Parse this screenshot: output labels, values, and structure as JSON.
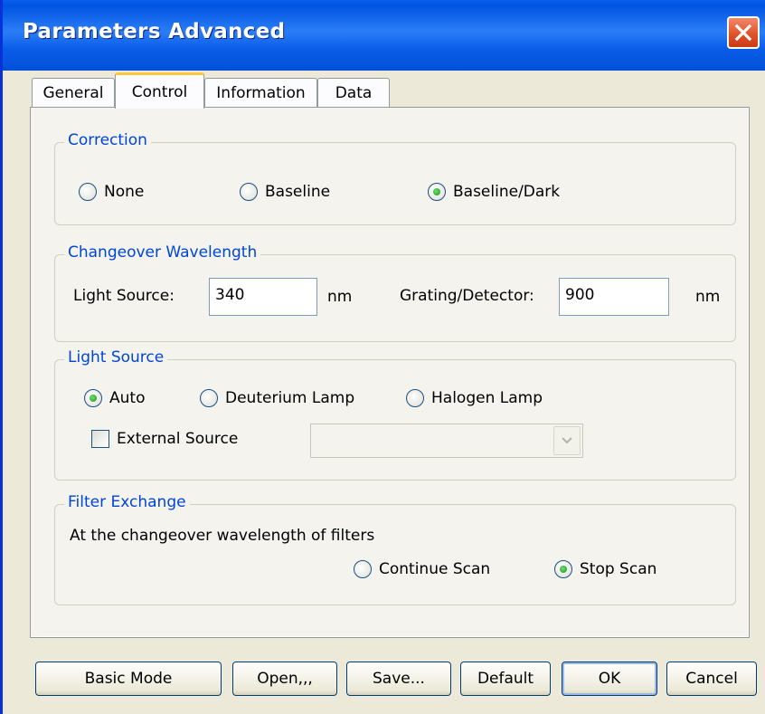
{
  "window": {
    "title": "Parameters  Advanced"
  },
  "tabs": [
    {
      "label": "General"
    },
    {
      "label": "Control"
    },
    {
      "label": "Information"
    },
    {
      "label": "Data"
    }
  ],
  "correction": {
    "label": "Correction",
    "options": [
      {
        "label": "None",
        "selected": false
      },
      {
        "label": "Baseline",
        "selected": false
      },
      {
        "label": "Baseline/Dark",
        "selected": true
      }
    ]
  },
  "changeover": {
    "label": "Changeover Wavelength",
    "light_source_label": "Light Source:",
    "light_source_value": "340",
    "light_source_unit": "nm",
    "grating_label": "Grating/Detector:",
    "grating_value": "900",
    "grating_unit": "nm"
  },
  "light_source": {
    "label": "Light Source",
    "options": [
      {
        "label": "Auto",
        "selected": true
      },
      {
        "label": "Deuterium Lamp",
        "selected": false
      },
      {
        "label": "Halogen Lamp",
        "selected": false
      }
    ],
    "external_label": "External Source",
    "external_checked": false,
    "external_combo_value": ""
  },
  "filter_exchange": {
    "label": "Filter Exchange",
    "description": "At the changeover wavelength of filters",
    "options": [
      {
        "label": "Continue Scan",
        "selected": false
      },
      {
        "label": "Stop Scan",
        "selected": true
      }
    ]
  },
  "buttons": {
    "basic_mode": "Basic Mode",
    "open": "Open,,,",
    "save": "Save...",
    "default": "Default",
    "ok": "OK",
    "cancel": "Cancel"
  },
  "colors": {
    "title_bar": "#0054e3",
    "group_label": "#0046d5",
    "tab_highlight": "#ffc83c",
    "close_button": "#e0532a"
  }
}
